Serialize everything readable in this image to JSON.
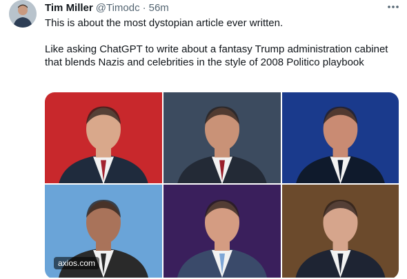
{
  "tweet": {
    "display_name": "Tim Miller",
    "handle": "@Timodc",
    "separator": "·",
    "timestamp": "56m",
    "paragraphs": [
      "This is about the most dystopian article ever written.",
      "Like asking ChatGPT to write about a fantasy Trump administration cabinet that blends Nazis and celebrities in the style of 2008 Politico playbook"
    ],
    "more_icon": "more-horizontal-icon"
  },
  "media": {
    "watermark": "axios.com",
    "photos": [
      {
        "name": "photo-1",
        "colors": {
          "bg": "#c8282c",
          "suit": "#1f2b3d",
          "skin": "#d9a88b",
          "tie": "#a32330"
        }
      },
      {
        "name": "photo-2",
        "colors": {
          "bg": "#3c4b5f",
          "suit": "#232a36",
          "skin": "#c99277",
          "tie": "#9a1f2b"
        }
      },
      {
        "name": "photo-3",
        "colors": {
          "bg": "#1a3a8c",
          "suit": "#0f1a2c",
          "skin": "#c98b73",
          "tie": "#0f1a2c"
        }
      },
      {
        "name": "photo-4",
        "colors": {
          "bg": "#6aa4d8",
          "suit": "#2a2a2a",
          "skin": "#a9735a",
          "tie": "#2a2a2a"
        }
      },
      {
        "name": "photo-5",
        "colors": {
          "bg": "#3a1f5c",
          "suit": "#3a4a6a",
          "skin": "#d49c82",
          "tie": "#7fa6d6"
        }
      },
      {
        "name": "photo-6",
        "colors": {
          "bg": "#6b4a2c",
          "suit": "#1e2433",
          "skin": "#d6a58c",
          "tie": "#1e2433"
        }
      }
    ]
  }
}
